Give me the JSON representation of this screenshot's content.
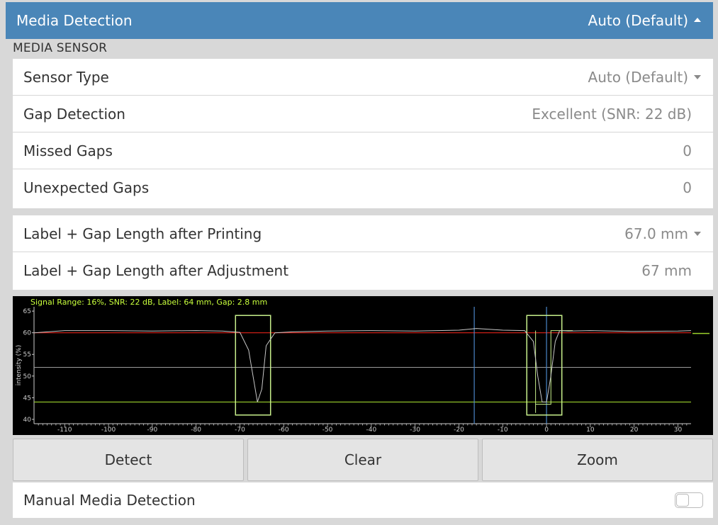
{
  "header": {
    "title": "Media Detection",
    "value": "Auto (Default)"
  },
  "section_title": "MEDIA SENSOR",
  "group1": [
    {
      "label": "Sensor Type",
      "value": "Auto (Default)"
    },
    {
      "label": "Gap Detection",
      "value": "Excellent (SNR: 22 dB)"
    },
    {
      "label": "Missed Gaps",
      "value": "0"
    },
    {
      "label": "Unexpected Gaps",
      "value": "0"
    }
  ],
  "group2": [
    {
      "label": "Label + Gap Length after Printing",
      "value": "67.0 mm"
    },
    {
      "label": "Label + Gap Length after Adjustment",
      "value": "67 mm"
    }
  ],
  "chart_data": {
    "type": "line",
    "title": "Signal Range: 16%, SNR: 22 dB, Label: 64 mm, Gap: 2.8 mm",
    "xlabel": "",
    "ylabel": "intensity (%)",
    "xlim": [
      -117,
      33
    ],
    "ylim": [
      39,
      66
    ],
    "x_ticks": [
      -110,
      -100,
      -90,
      -80,
      -70,
      -60,
      -50,
      -40,
      -30,
      -20,
      -10,
      0,
      10,
      20,
      30
    ],
    "y_ticks": [
      40,
      45,
      50,
      55,
      60,
      65
    ],
    "reference_lines": {
      "red": 60,
      "gray": 52,
      "green": 44
    },
    "vertical_lines": [
      -16.5,
      0
    ],
    "gap_boxes": [
      [
        -71,
        -63
      ],
      [
        -4.5,
        3.5
      ]
    ],
    "series": [
      {
        "color": "#c8c8c8",
        "x": [
          -117,
          -110,
          -100,
          -90,
          -80,
          -74,
          -70,
          -68,
          -67,
          -66,
          -65,
          -64,
          -62,
          -58,
          -50,
          -40,
          -30,
          -20,
          -16,
          -10,
          -5,
          -3,
          -2,
          -1,
          0,
          1,
          2,
          3,
          5,
          10,
          20,
          30,
          33
        ],
        "y": [
          60,
          60.5,
          60.5,
          60.4,
          60.5,
          60.4,
          60.1,
          56,
          50,
          44,
          47,
          57,
          60,
          60.2,
          60.4,
          60.5,
          60.4,
          60.6,
          61,
          60.6,
          60.5,
          58,
          50,
          44,
          44,
          50,
          58,
          60.5,
          60.4,
          60.5,
          60.3,
          60.4,
          60.5
        ]
      }
    ],
    "colors": {
      "background": "#000000",
      "title": "#c8ff3c",
      "red": "#e2231a",
      "green": "#9bd12c",
      "gray": "#9a9a9a",
      "signal": "#c8c8c8",
      "vertical": "#4a86c8",
      "box": "#c8f08c"
    }
  },
  "buttons": {
    "detect": "Detect",
    "clear": "Clear",
    "zoom": "Zoom"
  },
  "manual": {
    "label": "Manual Media Detection",
    "enabled": false
  }
}
